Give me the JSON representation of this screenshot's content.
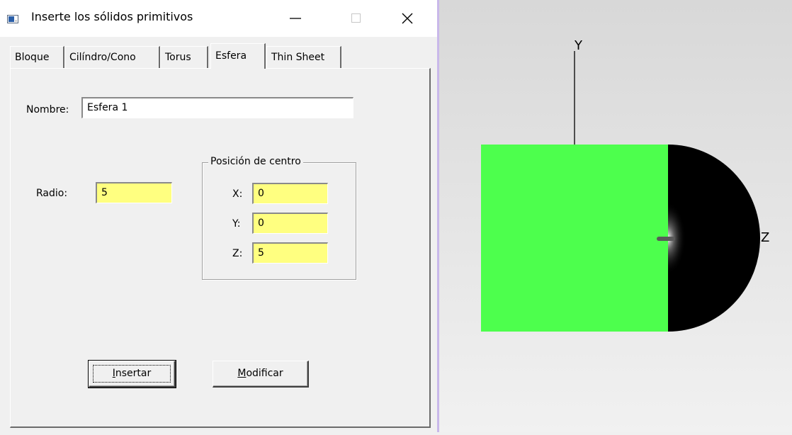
{
  "window": {
    "title": "Inserte los sólidos primitivos"
  },
  "tabs": [
    {
      "label": "Bloque"
    },
    {
      "label": "Cilíndro/Cono"
    },
    {
      "label": "Torus"
    },
    {
      "label": "Esfera"
    },
    {
      "label": "Thin Sheet"
    }
  ],
  "form": {
    "nombre_label": "Nombre:",
    "nombre_value": "Esfera 1",
    "radio_label": "Radio:",
    "radio_value": "5",
    "center_group_title": "Posición de centro",
    "x_label": "X:",
    "x_value": "0",
    "y_label": "Y:",
    "y_value": "0",
    "z_label": "Z:",
    "z_value": "5"
  },
  "buttons": {
    "insertar_mnemonic": "I",
    "insertar_rest": "nsertar",
    "modificar_mnemonic": "M",
    "modificar_rest": "odificar"
  },
  "viewport": {
    "y_axis_label": "Y",
    "z_axis_label": "Z",
    "colors": {
      "block": "#4dff4d",
      "sphere": "#000000",
      "axis": "#000000"
    }
  }
}
